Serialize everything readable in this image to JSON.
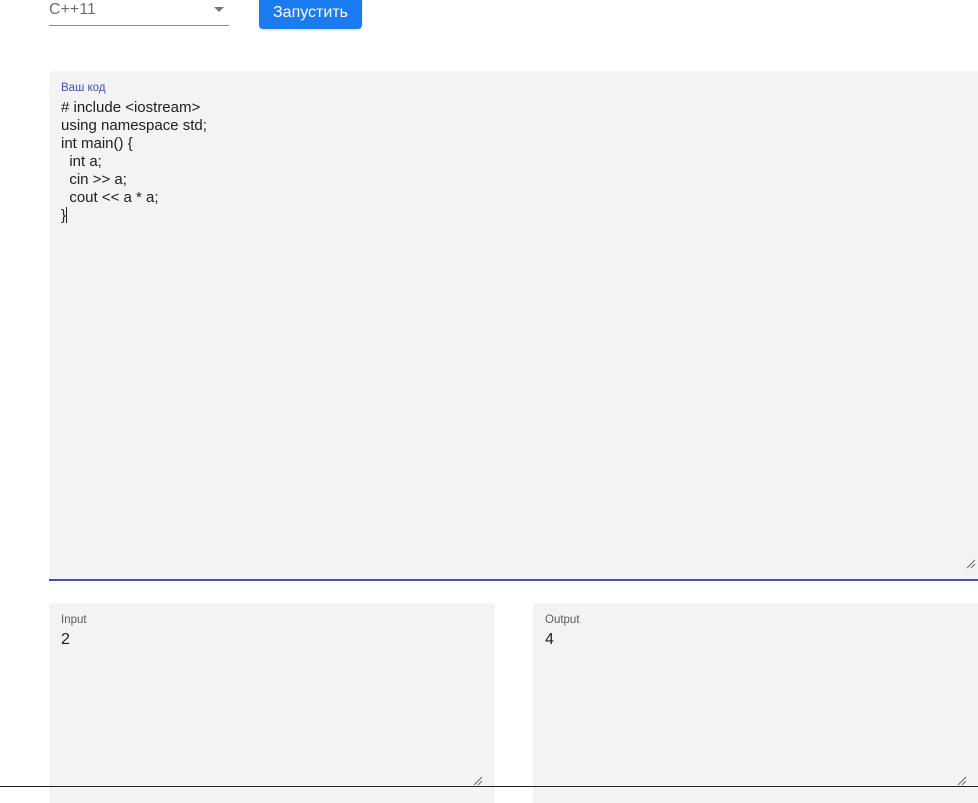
{
  "language_select": {
    "value": "C++11",
    "icon": "chevron-down-icon"
  },
  "run_button": {
    "label": "Запустить",
    "color": "#1a7cf0"
  },
  "code_editor": {
    "label": "Ваш код",
    "lines": [
      "# include <iostream>",
      "using namespace std;",
      "int main() {",
      "  int a;",
      "  cin >> a;",
      "  cout << a * a;",
      "}"
    ],
    "focus_color": "#3f51b5"
  },
  "input_box": {
    "label": "Input",
    "value": "2"
  },
  "output_box": {
    "label": "Output",
    "value": "4"
  }
}
